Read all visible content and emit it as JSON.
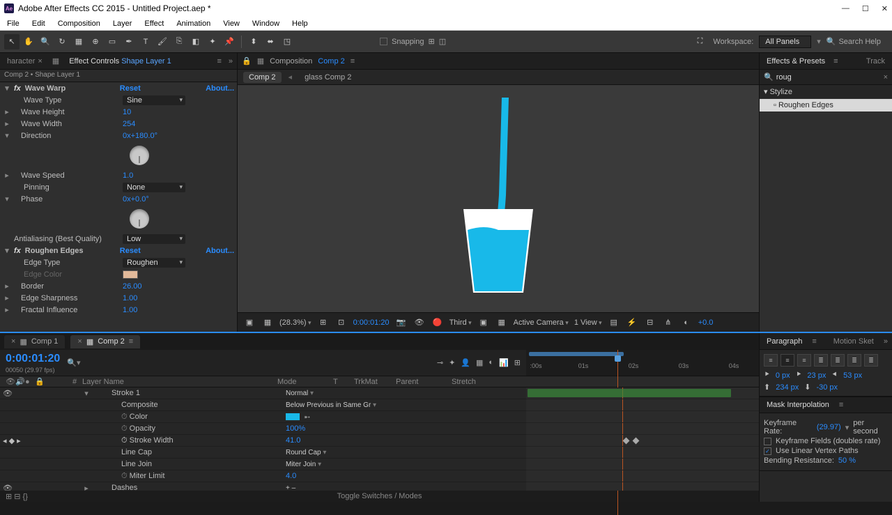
{
  "titlebar": {
    "title": "Adobe After Effects CC 2015 - Untitled Project.aep *"
  },
  "menu": [
    "File",
    "Edit",
    "Composition",
    "Layer",
    "Effect",
    "Animation",
    "View",
    "Window",
    "Help"
  ],
  "toolbar": {
    "snapping": "Snapping",
    "workspace_label": "Workspace:",
    "workspace_value": "All Panels",
    "search_help": "Search Help"
  },
  "effect_controls": {
    "tab_character": "haracter",
    "tab_ec": "Effect Controls",
    "tab_layer": "Shape Layer 1",
    "subtitle": "Comp 2 • Shape Layer 1",
    "wave_warp": {
      "name": "Wave Warp",
      "reset": "Reset",
      "about": "About...",
      "props": {
        "wave_type_l": "Wave Type",
        "wave_type_v": "Sine",
        "wave_height_l": "Wave Height",
        "wave_height_v": "10",
        "wave_width_l": "Wave Width",
        "wave_width_v": "254",
        "direction_l": "Direction",
        "direction_v": "0x+180.0°",
        "wave_speed_l": "Wave Speed",
        "wave_speed_v": "1.0",
        "pinning_l": "Pinning",
        "pinning_v": "None",
        "phase_l": "Phase",
        "phase_v": "0x+0.0°",
        "antialias_l": "Antialiasing (Best Quality)",
        "antialias_v": "Low"
      }
    },
    "roughen": {
      "name": "Roughen Edges",
      "reset": "Reset",
      "about": "About...",
      "props": {
        "edge_type_l": "Edge Type",
        "edge_type_v": "Roughen",
        "edge_color_l": "Edge Color",
        "border_l": "Border",
        "border_v": "26.00",
        "edge_sharp_l": "Edge Sharpness",
        "edge_sharp_v": "1.00",
        "fractal_l": "Fractal Influence",
        "fractal_v": "1.00"
      }
    }
  },
  "composition": {
    "panel_label": "Composition",
    "panel_comp": "Comp 2",
    "tab1": "Comp 2",
    "tab2": "glass Comp 2",
    "toolbar": {
      "zoom": "(28.3%)",
      "timecode": "0:00:01:20",
      "resolution": "Third",
      "camera": "Active Camera",
      "view": "1 View",
      "exposure": "+0.0"
    }
  },
  "effects_presets": {
    "tab1": "Effects & Presets",
    "tab2": "Track",
    "search": "roug",
    "category": "Stylize",
    "item": "Roughen Edges"
  },
  "timeline": {
    "tab1": "Comp 1",
    "tab2": "Comp 2",
    "timecode": "0:00:01:20",
    "frames": "00050 (29.97 fps)",
    "cols": {
      "num": "#",
      "layer": "Layer Name",
      "mode": "Mode",
      "t": "T",
      "trkmat": "TrkMat",
      "parent": "Parent",
      "stretch": "Stretch"
    },
    "ticks": [
      ":00s",
      "01s",
      "02s",
      "03s",
      "04s"
    ],
    "layers": {
      "stroke1": "Stroke 1",
      "composite_l": "Composite",
      "composite_v": "Below Previous in Same Gr",
      "normal": "Normal",
      "color_l": "Color",
      "opacity_l": "Opacity",
      "opacity_v": "100%",
      "stroke_width_l": "Stroke Width",
      "stroke_width_v": "41.0",
      "line_cap_l": "Line Cap",
      "line_cap_v": "Round Cap",
      "line_join_l": "Line Join",
      "line_join_v": "Miter Join",
      "miter_l": "Miter Limit",
      "miter_v": "4.0",
      "dashes_l": "Dashes",
      "dashes_v": "+  –"
    },
    "footer": "Toggle Switches / Modes"
  },
  "paragraph": {
    "tab1": "Paragraph",
    "tab2": "Motion Sket",
    "indents": {
      "left": "0 px",
      "right": "23 px",
      "first": "53 px",
      "before": "234 px",
      "after": "-30 px"
    }
  },
  "mask_interp": {
    "title": "Mask Interpolation",
    "rate_l": "Keyframe Rate:",
    "rate_v": "(29.97)",
    "rate_unit": "per second",
    "fields": "Keyframe Fields (doubles rate)",
    "linear": "Use Linear Vertex Paths",
    "bending": "Bending Resistance:",
    "bending_v": "50 %"
  }
}
